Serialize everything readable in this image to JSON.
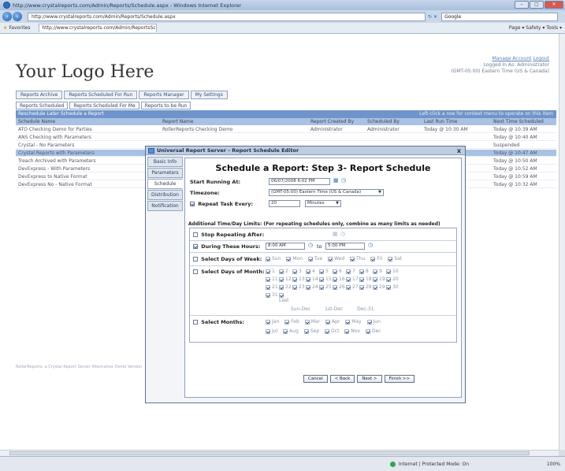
{
  "browser": {
    "title": "http://www.crystalreports.com/Admin/Reports/Schedule.aspx - Windows Internet Explorer",
    "url": "http://www.crystalreports.com/Admin/Reports/Schedule.aspx",
    "search_placeholder": "Google",
    "favorites_label": "Favorites",
    "tab_label": "http://www.crystalreports.com/Admin/ReportsSch...",
    "tools": "Page ▾  Safety ▾  Tools ▾",
    "nav_back": "‹",
    "nav_fwd": "›",
    "refresh": "↻",
    "stop": "✕",
    "minimize": "–",
    "maximize": "▢",
    "close": "✕"
  },
  "header": {
    "logo": "Your Logo Here",
    "manage_account": "Manage Account",
    "logout": "Logout",
    "logged_in_as": "Logged In As: Administrator",
    "timezone_note": "(GMT-05:00) Eastern Time (US & Canada)"
  },
  "nav": {
    "tabs": [
      "Reports Archive",
      "Reports Scheduled For Run",
      "Reports Manager",
      "My Settings"
    ],
    "subtabs": [
      "Reports Scheduled",
      "Reports Scheduled For Me",
      "Reports to be Run"
    ]
  },
  "list": {
    "toolbar_left": "Reschedule Later   Schedule a Report",
    "toolbar_right": "Left-click a row for context menu to operate on this item",
    "columns": [
      "Schedule Name",
      "Report Name",
      "Report Created By",
      "Scheduled By",
      "Last Run Time",
      "Next Time Scheduled"
    ],
    "rows": [
      [
        "ATO Checking Demo for Parties",
        "RollerReports Checking Demo",
        "Administrator",
        "Administrator",
        "Today @ 10:30 AM",
        "Today @ 10:39 AM"
      ],
      [
        "ANS Checking with Parameters",
        "",
        "",
        "",
        "",
        "Today @ 10:40 AM"
      ],
      [
        "Crystal - No Parameters",
        "",
        "",
        "",
        "",
        "Suspended"
      ],
      [
        "Crystal Reports with Parameters",
        "",
        "",
        "",
        "",
        "Today @ 10:47 AM"
      ],
      [
        "Treach Archived with Parameters",
        "",
        "",
        "",
        "",
        "Today @ 10:50 AM"
      ],
      [
        "DevExpress - With Parameters",
        "",
        "",
        "",
        "",
        "Today @ 10:52 AM"
      ],
      [
        "DevExpress to Native Format",
        "",
        "",
        "",
        "",
        "Today @ 10:59 AM"
      ],
      [
        "DevExpress No - Native Format",
        "",
        "",
        "",
        "",
        "Today @ 10:32 AM"
      ]
    ],
    "footnote": "RollerReports, a Crystal Report Server Alternative Demo Version"
  },
  "dialog": {
    "title": "Universal Report Server - Report Schedule Editor",
    "close": "x",
    "side_tabs": [
      "Basic Info",
      "Parameters",
      "Schedule",
      "Distribution",
      "Notification"
    ],
    "heading": "Schedule a Report: Step 3- Report Schedule",
    "start_label": "Start Running At:",
    "start_value": "06/07/2008 6:02 PM",
    "timezone_label": "Timezone:",
    "timezone_value": "(GMT-05:00) Eastern Time (US & Canada)",
    "repeat_label": "Repeat Task Every:",
    "repeat_value": "20",
    "repeat_unit": "Minutes",
    "limits_heading": "Additional Time/Day Limits: (For repeating schedules only, combine as many limits as needed)",
    "stop_after": "Stop Repeating After:",
    "during_hours": "During These Hours:",
    "hours_from": "8:00 AM",
    "hours_to_label": "to",
    "hours_to": "5:00 PM",
    "days_week_label": "Select Days of Week:",
    "days_week": [
      "Sun",
      "Mon",
      "Tue",
      "Wed",
      "Thu",
      "Fri",
      "Sat"
    ],
    "days_month_label": "Select Days of Month:",
    "days_month": [
      "1",
      "2",
      "3",
      "4",
      "5",
      "6",
      "7",
      "8",
      "9",
      "10",
      "11",
      "12",
      "13",
      "14",
      "15",
      "16",
      "17",
      "18",
      "19",
      "20",
      "21",
      "22",
      "23",
      "24",
      "25",
      "26",
      "27",
      "28",
      "29",
      "30",
      "31",
      "Last"
    ],
    "days_month_shortcuts": [
      "Sun-Dec",
      "1st-Dec",
      "Dec-31"
    ],
    "months_label": "Select Months:",
    "months_row1": [
      "Jan",
      "Feb",
      "Mar",
      "Apr",
      "May",
      "Jun"
    ],
    "months_row2": [
      "Jul",
      "Aug",
      "Sep",
      "Oct",
      "Nov",
      "Dec"
    ],
    "buttons": [
      "Cancel",
      "< Back",
      "Next >",
      "Finish >>"
    ]
  },
  "status": {
    "zone": "Internet | Protected Mode: On",
    "zoom": "100%"
  }
}
